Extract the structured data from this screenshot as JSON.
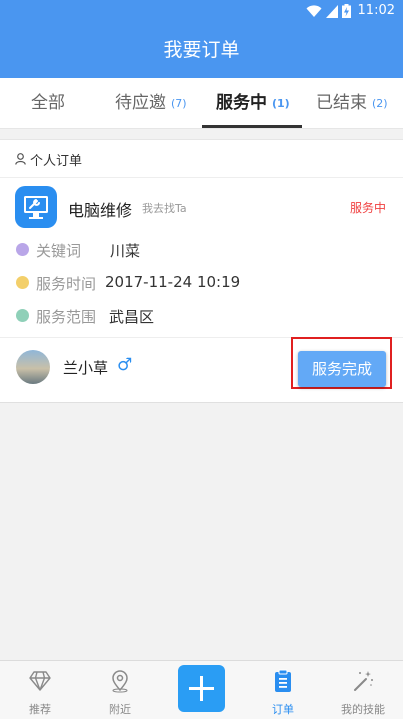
{
  "status_bar": {
    "time": "11:02"
  },
  "header": {
    "title": "我要订单"
  },
  "tabs": [
    {
      "label": "全部",
      "count": ""
    },
    {
      "label": "待应邀",
      "count": "(7)"
    },
    {
      "label": "服务中",
      "count": "(1)"
    },
    {
      "label": "已结束",
      "count": "(2)"
    }
  ],
  "order": {
    "section_label": "个人订单",
    "service_title": "电脑维修",
    "service_sub": "我去找Ta",
    "status": "服务中",
    "rows": [
      {
        "key": "关键词",
        "value": "川菜",
        "dot_color": "#b9a6e8"
      },
      {
        "key": "服务时间",
        "value": "2017-11-24 10:19",
        "dot_color": "#f3cf6a"
      },
      {
        "key": "服务范围",
        "value": "武昌区",
        "dot_color": "#8fd0b8"
      }
    ],
    "user_name": "兰小草",
    "gender_symbol": "♂",
    "complete_button": "服务完成"
  },
  "bottom_nav": [
    {
      "label": "推荐",
      "icon": "diamond-icon"
    },
    {
      "label": "附近",
      "icon": "location-pin-icon"
    },
    {
      "label": "",
      "icon": "plus-icon"
    },
    {
      "label": "订单",
      "icon": "clipboard-icon"
    },
    {
      "label": "我的技能",
      "icon": "magic-wand-icon"
    }
  ],
  "colors": {
    "primary": "#4a96f0",
    "accent": "#2a8ef0",
    "status_red": "#f04040",
    "highlight_red": "#e02020"
  }
}
